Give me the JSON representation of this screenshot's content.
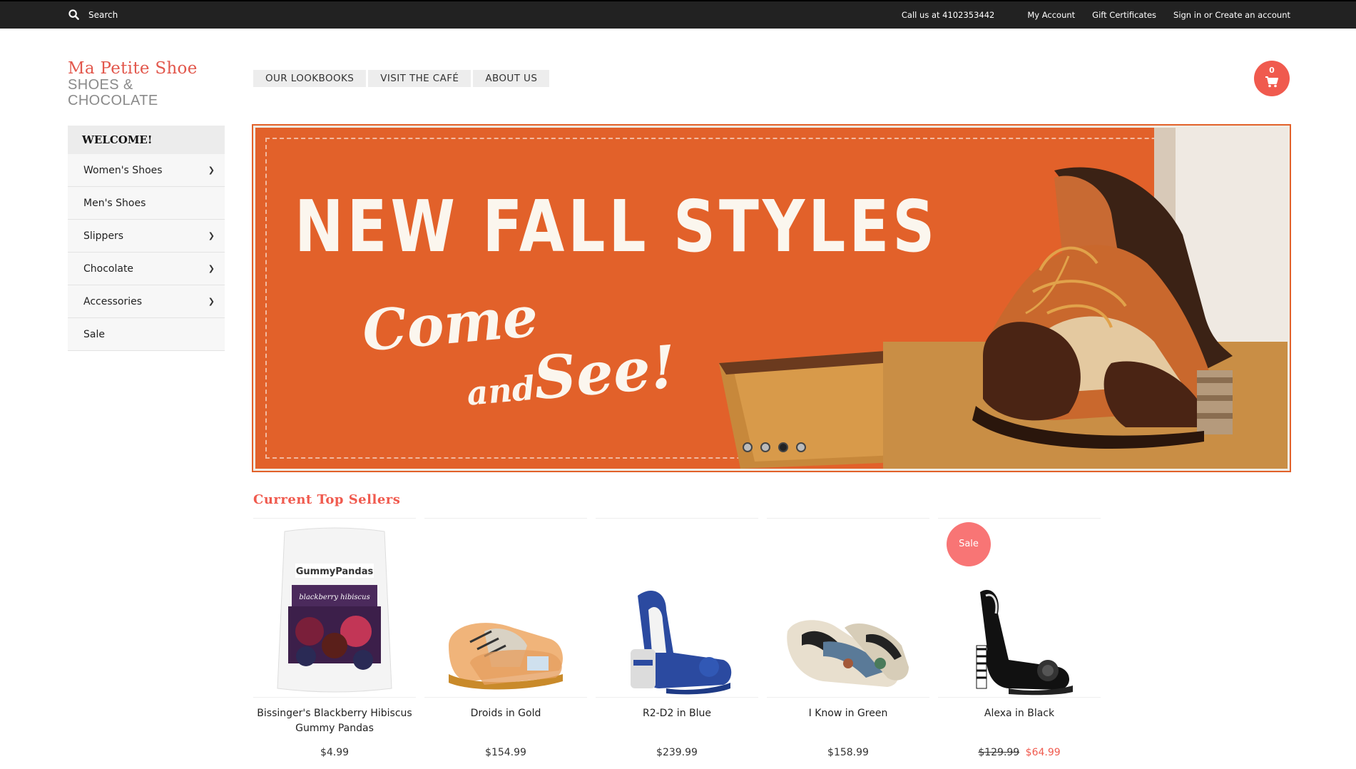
{
  "topbar": {
    "search_label": "Search",
    "call": "Call us at 4102353442",
    "my_account": "My Account",
    "gift_certificates": "Gift Certificates",
    "sign_in": "Sign in or Create an account"
  },
  "logo": {
    "line1": "Ma Petite Shoe",
    "line2": "SHOES & CHOCOLATE"
  },
  "nav": [
    "OUR LOOKBOOKS",
    "VISIT THE CAFÉ",
    "ABOUT US"
  ],
  "cart": {
    "count": "0"
  },
  "sidebar": {
    "welcome": "WELCOME!",
    "items": [
      {
        "label": "Women's Shoes",
        "has_submenu": true
      },
      {
        "label": "Men's Shoes",
        "has_submenu": false
      },
      {
        "label": "Slippers",
        "has_submenu": true
      },
      {
        "label": "Chocolate",
        "has_submenu": true
      },
      {
        "label": "Accessories",
        "has_submenu": true
      },
      {
        "label": "Sale",
        "has_submenu": false
      }
    ]
  },
  "banner": {
    "title": "NEW FALL STYLES",
    "come": "Come",
    "and": "and",
    "see": "See!",
    "slides": 4,
    "active_slide": 3
  },
  "top_sellers": {
    "title": "Current Top Sellers",
    "products": [
      {
        "name": "Bissinger's Blackberry Hibiscus Gummy Pandas",
        "price": "$4.99",
        "image": "gummy-pandas-bag"
      },
      {
        "name": "Droids in Gold",
        "price": "$154.99",
        "image": "gold-droid-oxfords"
      },
      {
        "name": "R2-D2 in Blue",
        "price": "$239.99",
        "image": "r2d2-blue-heels"
      },
      {
        "name": "I Know in Green",
        "price": "$158.99",
        "image": "green-print-flats"
      },
      {
        "name": "Alexa in Black",
        "old_price": "$129.99",
        "price": "$64.99",
        "sale": "Sale",
        "image": "black-slingback-heels"
      }
    ]
  },
  "colors": {
    "accent": "#f05a4e",
    "topbar": "#222222",
    "banner": "#e2612a"
  }
}
